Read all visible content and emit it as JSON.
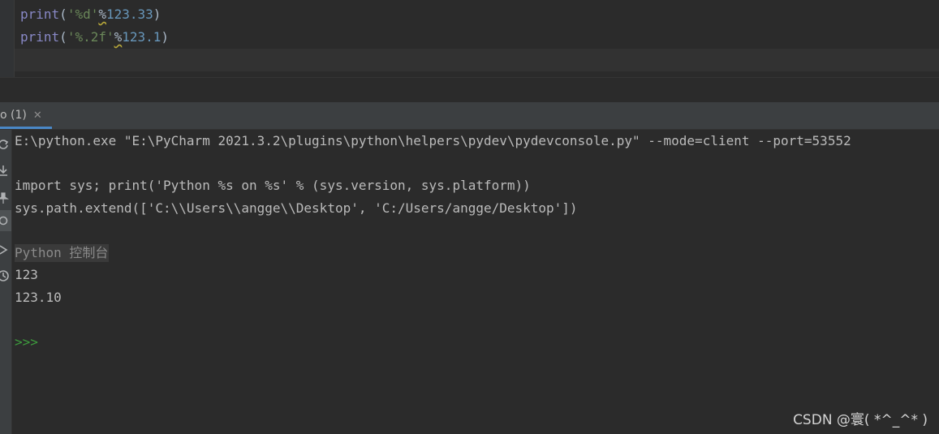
{
  "editor": {
    "lines": [
      {
        "fn": "print",
        "open": "(",
        "str": "'%d'",
        "op": "%",
        "num": "123.33",
        "close": ")"
      },
      {
        "fn": "print",
        "open": "(",
        "str": "'%.2f'",
        "op": "%",
        "num": "123.1",
        "close": ")"
      }
    ]
  },
  "console_panel": {
    "tab_label": "o (1)",
    "tab_close": "✕",
    "toolbar_icons": [
      "rerun-icon",
      "scroll-to-end-icon",
      "pin-icon",
      "watch-icon",
      "execute-icon",
      "history-icon"
    ],
    "lines": [
      "E:\\python.exe \"E:\\PyCharm 2021.3.2\\plugins\\python\\helpers\\pydev\\pydevconsole.py\" --mode=client --port=53552",
      "import sys; print('Python %s on %s' % (sys.version, sys.platform))",
      "sys.path.extend(['C:\\\\Users\\\\angge\\\\Desktop', 'C:/Users/angge/Desktop'])",
      "Python 控制台",
      "123",
      "123.10"
    ],
    "prompt": ">>>"
  },
  "watermark": "CSDN @寰( *^_^* )",
  "colors": {
    "background": "#2b2b2b",
    "keyword_fn": "#8888c6",
    "string": "#6a8759",
    "number": "#6897bb",
    "prompt": "#3d9b3d",
    "tab_underline": "#4a88c7"
  }
}
